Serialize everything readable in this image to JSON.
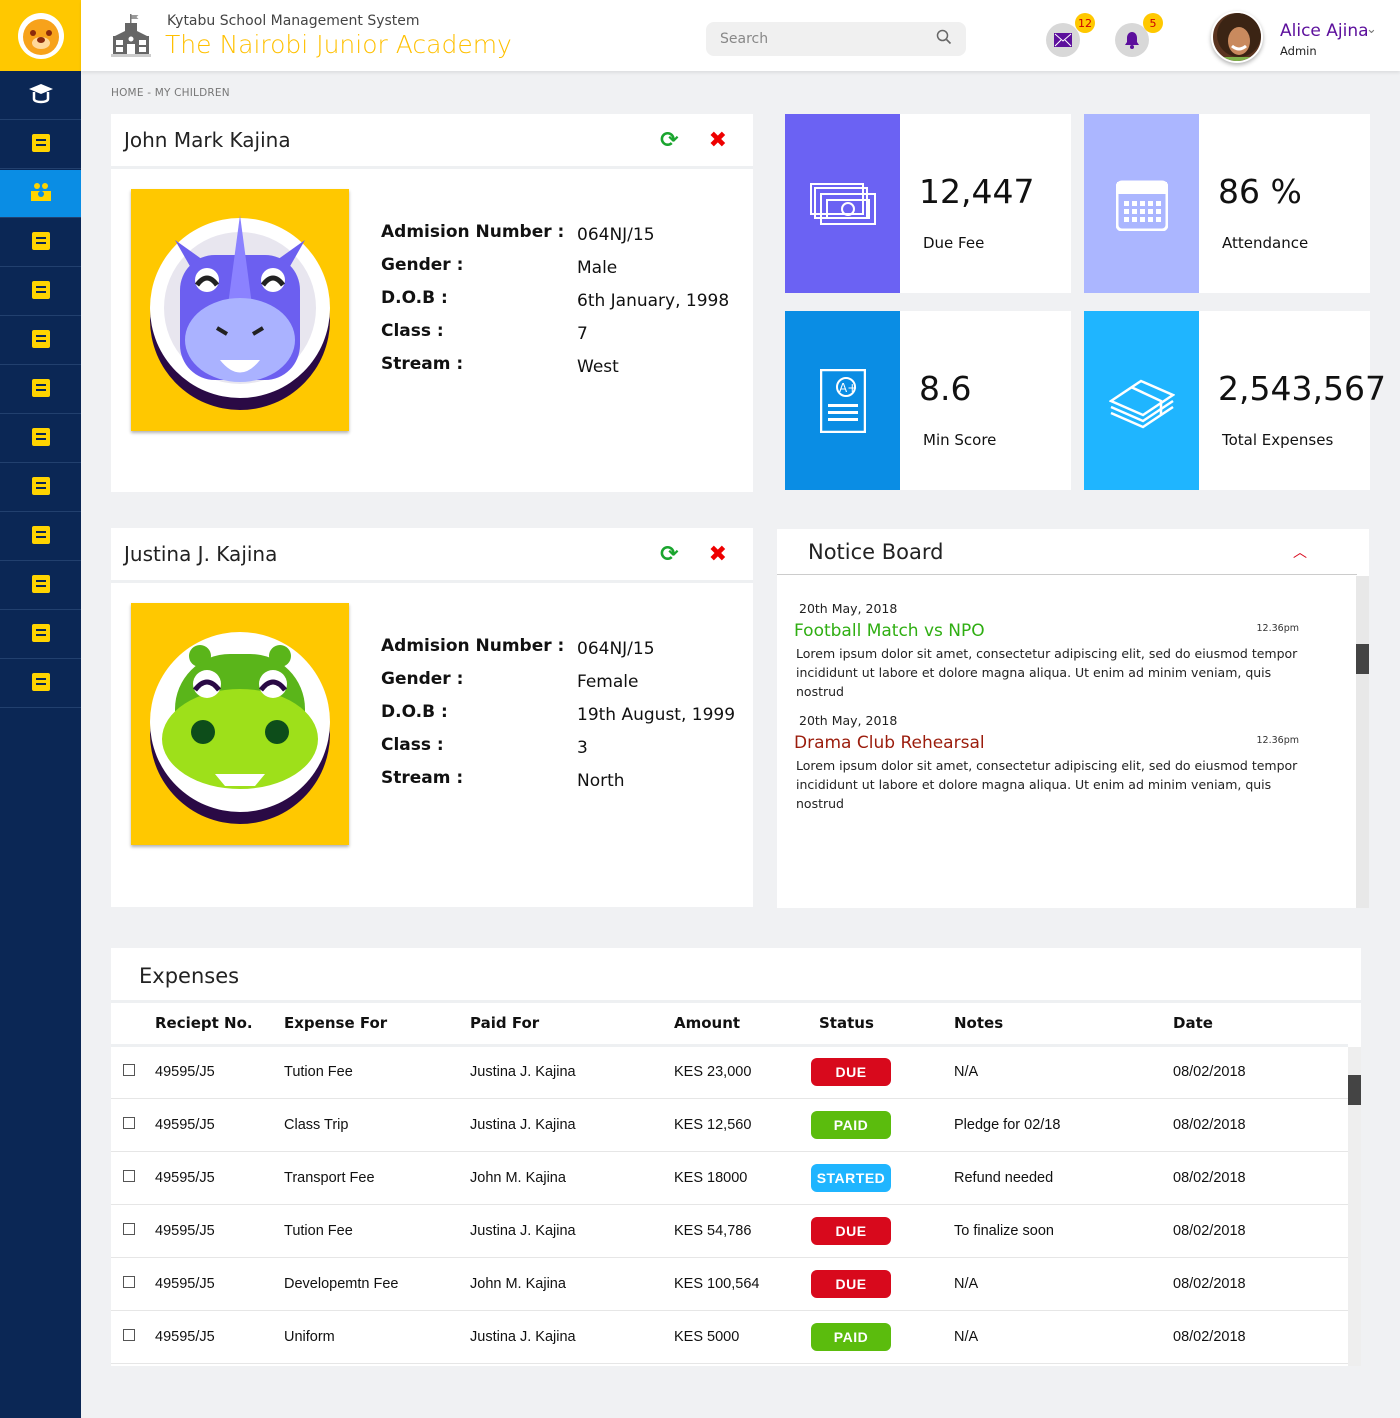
{
  "header": {
    "system_name": "Kytabu School Management System",
    "school_name": "The Nairobi Junior Academy",
    "search_placeholder": "Search",
    "messages_count": "12",
    "notifications_count": "5",
    "user_name": "Alice Ajina",
    "user_role": "Admin"
  },
  "sidebar": {
    "items": [
      {
        "icon": "graduate-icon"
      },
      {
        "icon": "teacher-icon"
      },
      {
        "icon": "children-icon",
        "active": true
      },
      {
        "icon": "profile-icon"
      },
      {
        "icon": "clipboard-icon"
      },
      {
        "icon": "students-walking-icon"
      },
      {
        "icon": "report-card-icon"
      },
      {
        "icon": "checkbox-icon"
      },
      {
        "icon": "bus-icon"
      },
      {
        "icon": "library-icon"
      },
      {
        "icon": "calendar-icon"
      },
      {
        "icon": "timetable-icon"
      },
      {
        "icon": "sports-icon"
      }
    ]
  },
  "breadcrumb": "HOME -  MY CHILDREN",
  "children": [
    {
      "name": "John Mark Kajina",
      "avatar": "rhino",
      "fields": [
        {
          "label": "Admision Number :",
          "value": "064NJ/15"
        },
        {
          "label": "Gender :",
          "value": "Male"
        },
        {
          "label": "D.O.B :",
          "value": "6th January, 1998"
        },
        {
          "label": "Class :",
          "value": "7"
        },
        {
          "label": "Stream :",
          "value": "West"
        }
      ]
    },
    {
      "name": "Justina J. Kajina",
      "avatar": "hippo",
      "fields": [
        {
          "label": "Admision Number :",
          "value": "064NJ/15"
        },
        {
          "label": "Gender :",
          "value": "Female"
        },
        {
          "label": "D.O.B :",
          "value": "19th August, 1999"
        },
        {
          "label": "Class :",
          "value": "3"
        },
        {
          "label": "Stream :",
          "value": "North"
        }
      ]
    }
  ],
  "stats": [
    {
      "value": "12,447",
      "label": "Due Fee",
      "color": "#6b62f3",
      "icon": "money-icon"
    },
    {
      "value": "86 %",
      "label": "Attendance",
      "color": "#abb6ff",
      "icon": "calendar-icon"
    },
    {
      "value": "8.6",
      "label": "Min Score",
      "color": "#0a8de4",
      "icon": "grade-sheet-icon"
    },
    {
      "value": "2,543,567",
      "label": "Total Expenses",
      "color": "#1fb5ff",
      "icon": "cash-stack-icon"
    }
  ],
  "notice_board": {
    "title": "Notice Board",
    "items": [
      {
        "date": "20th May, 2018",
        "title": "Football Match vs NPO",
        "time": "12.36pm",
        "color": "#2fae12",
        "body": "Lorem ipsum dolor sit amet, consectetur adipiscing elit, sed do eiusmod tempor incididunt ut labore et dolore magna aliqua. Ut enim ad minim veniam, quis nostrud"
      },
      {
        "date": "20th May, 2018",
        "title": "Drama Club Rehearsal",
        "time": "12.36pm",
        "color": "#9b1c0c",
        "body": "Lorem ipsum dolor sit amet, consectetur adipiscing elit, sed do eiusmod tempor incididunt ut labore et dolore magna aliqua. Ut enim ad minim veniam, quis nostrud"
      }
    ]
  },
  "expenses": {
    "title": "Expenses",
    "columns": [
      "Reciept No.",
      "Expense For",
      "Paid For",
      "Amount",
      "Status",
      "Notes",
      "Date"
    ],
    "rows": [
      {
        "receipt": "49595/J5",
        "expense": "Tution Fee",
        "paid_for": "Justina J. Kajina",
        "amount": "KES 23,000",
        "status": "DUE",
        "notes": "N/A",
        "date": "08/02/2018"
      },
      {
        "receipt": "49595/J5",
        "expense": "Class Trip",
        "paid_for": "Justina J. Kajina",
        "amount": "KES 12,560",
        "status": "PAID",
        "notes": "Pledge for 02/18",
        "date": "08/02/2018"
      },
      {
        "receipt": "49595/J5",
        "expense": "Transport Fee",
        "paid_for": "John M. Kajina",
        "amount": "KES 18000",
        "status": "STARTED",
        "notes": "Refund needed",
        "date": "08/02/2018"
      },
      {
        "receipt": "49595/J5",
        "expense": "Tution Fee",
        "paid_for": "Justina J. Kajina",
        "amount": "KES 54,786",
        "status": "DUE",
        "notes": "To finalize soon",
        "date": "08/02/2018"
      },
      {
        "receipt": "49595/J5",
        "expense": "Developemtn Fee",
        "paid_for": "John M. Kajina",
        "amount": "KES 100,564",
        "status": "DUE",
        "notes": "N/A",
        "date": "08/02/2018"
      },
      {
        "receipt": "49595/J5",
        "expense": "Uniform",
        "paid_for": "Justina J. Kajina",
        "amount": "KES 5000",
        "status": "PAID",
        "notes": "N/A",
        "date": "08/02/2018"
      }
    ]
  },
  "status_colors": {
    "DUE": "#d8091c",
    "PAID": "#5bbc0d",
    "STARTED": "#1fb5ff"
  }
}
